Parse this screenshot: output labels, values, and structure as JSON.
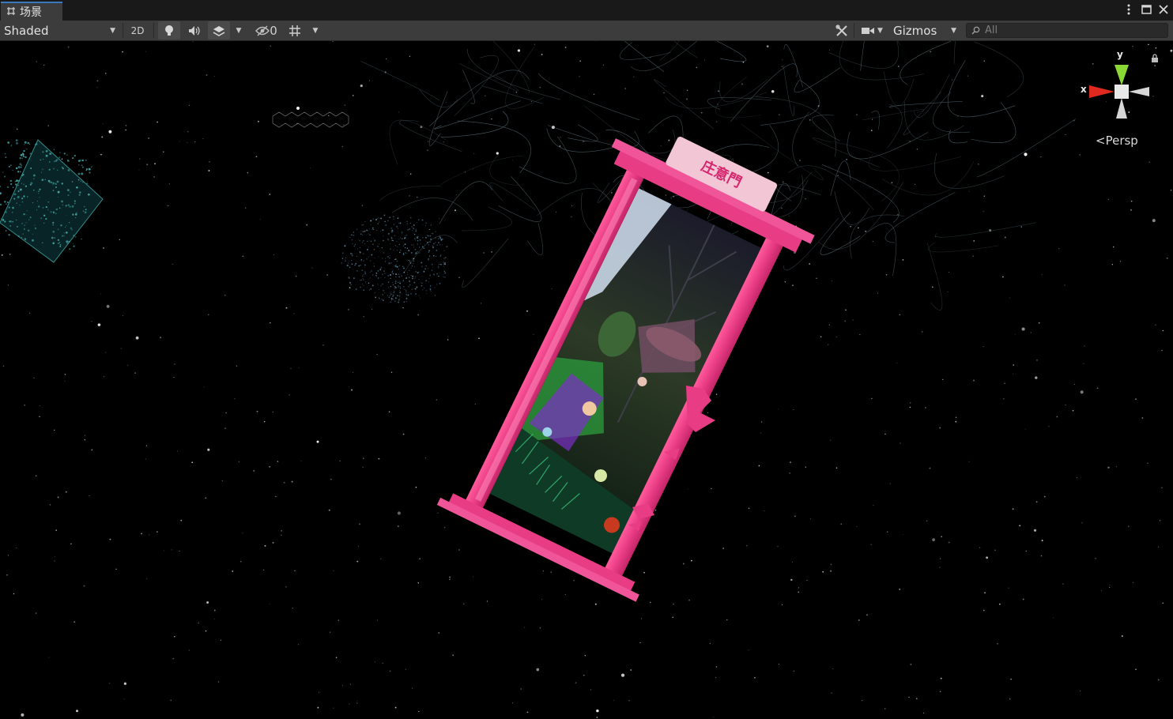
{
  "tab": {
    "title": "场景",
    "icon": "grid-icon"
  },
  "window_controls": [
    "more-icon",
    "maximize-icon",
    "close-icon"
  ],
  "toolbar": {
    "draw_mode": "Shaded",
    "two_d_label": "2D",
    "hidden_count": "0",
    "gizmos_label": "Gizmos",
    "search_placeholder": "All"
  },
  "viewport": {
    "projection_label": "Persp",
    "axes": {
      "x": "x",
      "y": "y"
    },
    "sign_text": "庄意門",
    "colors": {
      "background": "#000000",
      "door_frame": "#e83c84",
      "axis_x": "#e02a20",
      "axis_y": "#8bd834",
      "particles_cyan": "#4fc6c4"
    }
  }
}
